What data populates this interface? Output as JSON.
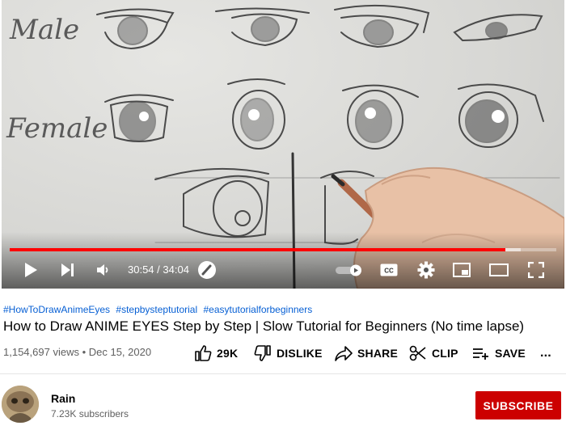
{
  "player": {
    "current_time": "30:54",
    "duration": "34:04",
    "time_separator": " / ",
    "played_fraction": 0.907,
    "buffered_fraction": 0.935,
    "sketch_labels": {
      "male": "Male",
      "female": "Female"
    },
    "controls": [
      "play-icon",
      "next-icon",
      "volume-icon",
      "miniplayer-toggle-icon",
      "autoplay-toggle",
      "captions-icon",
      "settings-gear-icon",
      "miniplayer-icon",
      "theater-mode-icon",
      "fullscreen-icon"
    ],
    "colors": {
      "progress": "#ff0000"
    }
  },
  "video": {
    "hashtags": [
      "#HowToDrawAnimeEyes",
      "#stepbysteptutorial",
      "#easytutorialforbeginners"
    ],
    "title": "How to Draw ANIME EYES Step by Step | Slow Tutorial for Beginners (No time lapse)",
    "views": "1,154,697 views",
    "date_separator": " • ",
    "date": "Dec 15, 2020"
  },
  "actions": {
    "like": "29K",
    "dislike": "DISLIKE",
    "share": "SHARE",
    "clip": "CLIP",
    "save": "SAVE",
    "more": "..."
  },
  "channel": {
    "name": "Rain",
    "subscribers": "7.23K subscribers",
    "subscribe_label": "SUBSCRIBE",
    "colors": {
      "subscribe": "#cc0000"
    }
  }
}
